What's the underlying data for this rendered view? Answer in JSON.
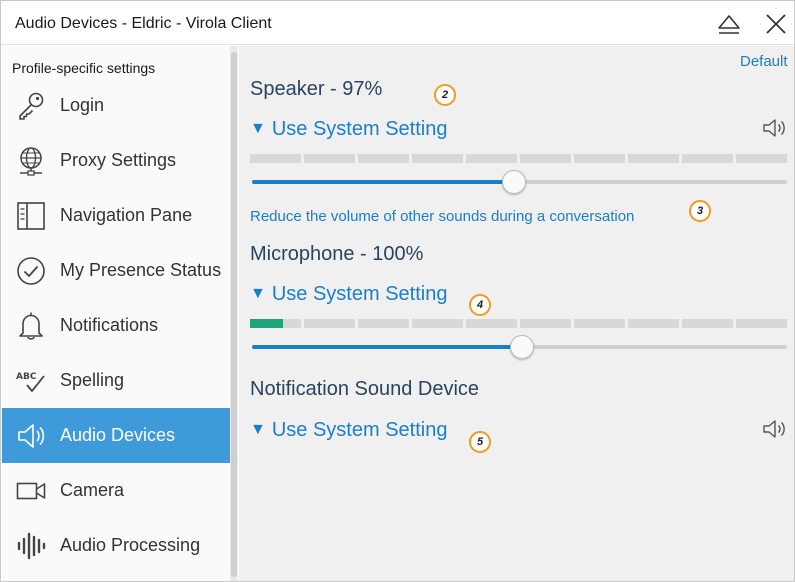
{
  "window": {
    "title": "Audio Devices - Eldric - Virola Client"
  },
  "titlebar": {
    "eject_icon": "eject-icon",
    "close_icon": "close-icon"
  },
  "sidebar": {
    "heading": "Profile-specific settings",
    "items": [
      {
        "label": "Login",
        "icon": "key-icon",
        "active": false
      },
      {
        "label": "Proxy Settings",
        "icon": "globe-network-icon",
        "active": false
      },
      {
        "label": "Navigation Pane",
        "icon": "panel-layout-icon",
        "active": false
      },
      {
        "label": "My Presence Status",
        "icon": "check-circle-icon",
        "active": false
      },
      {
        "label": "Notifications",
        "icon": "bell-icon",
        "active": false
      },
      {
        "label": "Spelling",
        "icon": "spellcheck-icon",
        "active": false
      },
      {
        "label": "Audio Devices",
        "icon": "speaker-icon",
        "active": true
      },
      {
        "label": "Camera",
        "icon": "camera-icon",
        "active": false
      },
      {
        "label": "Audio Processing",
        "icon": "waveform-icon",
        "active": false
      }
    ]
  },
  "main": {
    "default_label": "Default",
    "speaker": {
      "title": "Speaker - 97%",
      "device": "Use System Setting",
      "meter_level": 0.0,
      "volume_fraction": 0.49,
      "reduce_link": "Reduce the volume of other sounds during a conversation"
    },
    "microphone": {
      "title": "Microphone - 100%",
      "device": "Use System Setting",
      "meter_level": 0.065,
      "volume_fraction": 0.505
    },
    "notification": {
      "title": "Notification Sound Device",
      "device": "Use System Setting"
    },
    "badges": [
      "2",
      "3",
      "4",
      "5"
    ]
  },
  "colors": {
    "accent": "#1a7fc9",
    "active_nav": "#3e9ad8",
    "meter_green": "#1ea37a",
    "badge_border": "#f29a21"
  }
}
